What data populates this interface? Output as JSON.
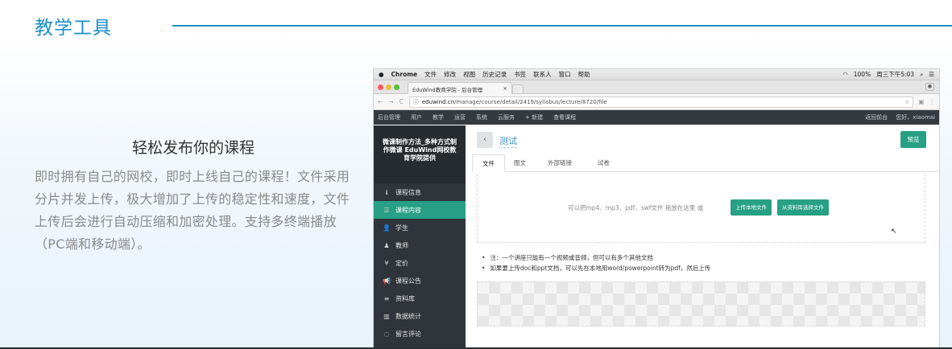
{
  "page": {
    "title": "教学工具",
    "feature_heading": "轻松发布你的课程",
    "feature_desc": "即时拥有自己的网校，即时上线自己的课程！文件采用分片并发上传，极大增加了上传的稳定性和速度，文件上传后会进行自动压缩和加密处理。支持多终端播放（PC端和移动端）。"
  },
  "mac_menu": {
    "apple": "",
    "items": [
      "Chrome",
      "文件",
      "修改",
      "视图",
      "历史记录",
      "书签",
      "联系人",
      "窗口",
      "帮助"
    ],
    "status": {
      "battery": "100%",
      "clock": "周三下午5:03"
    }
  },
  "browser": {
    "tab_title": "EduWind教育学院 - 后台管理",
    "tab_close": "×",
    "url_host": "eduwind.cn",
    "url_path": "/manage/course/detail/2419/syllabus/lecture/8720/file"
  },
  "admin_bar": {
    "items": [
      "后台管理",
      "用户",
      "教学",
      "运营",
      "系统",
      "云服务",
      "+ 新建",
      "查看课程"
    ],
    "right": [
      "返回前台",
      "您好，xiaomai"
    ]
  },
  "sidebar": {
    "course_title": "微课制作方法_多种方式制作微课 EduWind网校教育学院提供",
    "items": [
      {
        "label": "课程信息",
        "icon": "info-icon",
        "glyph": "ℹ"
      },
      {
        "label": "课程内容",
        "icon": "list-icon",
        "glyph": "☰",
        "active": true
      },
      {
        "label": "学生",
        "icon": "user-icon",
        "glyph": "👤"
      },
      {
        "label": "教师",
        "icon": "teacher-icon",
        "glyph": "♟"
      },
      {
        "label": "定价",
        "icon": "price-icon",
        "glyph": "¥"
      },
      {
        "label": "课程公告",
        "icon": "bullhorn-icon",
        "glyph": "📢"
      },
      {
        "label": "资料库",
        "icon": "database-icon",
        "glyph": "≡"
      },
      {
        "label": "数据统计",
        "icon": "chart-icon",
        "glyph": "▥"
      },
      {
        "label": "留言评论",
        "icon": "comment-icon",
        "glyph": "◌"
      }
    ]
  },
  "content": {
    "back": "‹",
    "lesson_name": "测试",
    "preview_label": "预览",
    "tabs": [
      "文件",
      "图文",
      "外部链接",
      "试卷"
    ],
    "upload_hint": "可以把mp4、mp3、pdf、swf文件 拖放在这里   或",
    "upload_local": "上传本地文件",
    "upload_library": "从资料库选择文件",
    "notes": [
      "注：一个讲座只能有一个视频或音频，但可以有多个其他文档",
      "如果要上传doc和ppt文档，可以先在本地用word/powerpoint转为pdf，然后上传"
    ]
  }
}
